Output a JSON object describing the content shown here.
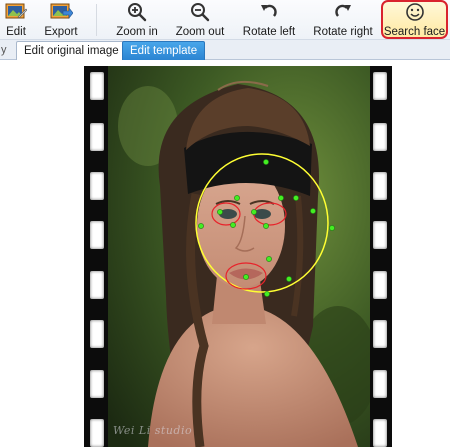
{
  "toolbar": {
    "edit_label": "Edit",
    "export_label": "Export",
    "zoom_in_label": "Zoom in",
    "zoom_out_label": "Zoom out",
    "rotate_left_label": "Rotate left",
    "rotate_right_label": "Rotate right",
    "search_face_label": "Search face",
    "icons": [
      "edit-image-icon",
      "export-image-icon",
      "zoom-in-icon",
      "zoom-out-icon",
      "rotate-left-icon",
      "rotate-right-icon",
      "smiley-face-icon"
    ]
  },
  "tabs": {
    "left_stub_label": "y",
    "items": [
      {
        "label": "Edit original image",
        "active": false
      },
      {
        "label": "Edit template",
        "active": true
      }
    ]
  },
  "canvas": {
    "signature": "Wei Li studio",
    "face_detection": {
      "outline_color": "#ffff33",
      "feature_color": "#e8222a",
      "point_color": "#44ee22"
    }
  },
  "colors": {
    "accent": "#2b84d2",
    "highlight_border": "#d9232e"
  }
}
